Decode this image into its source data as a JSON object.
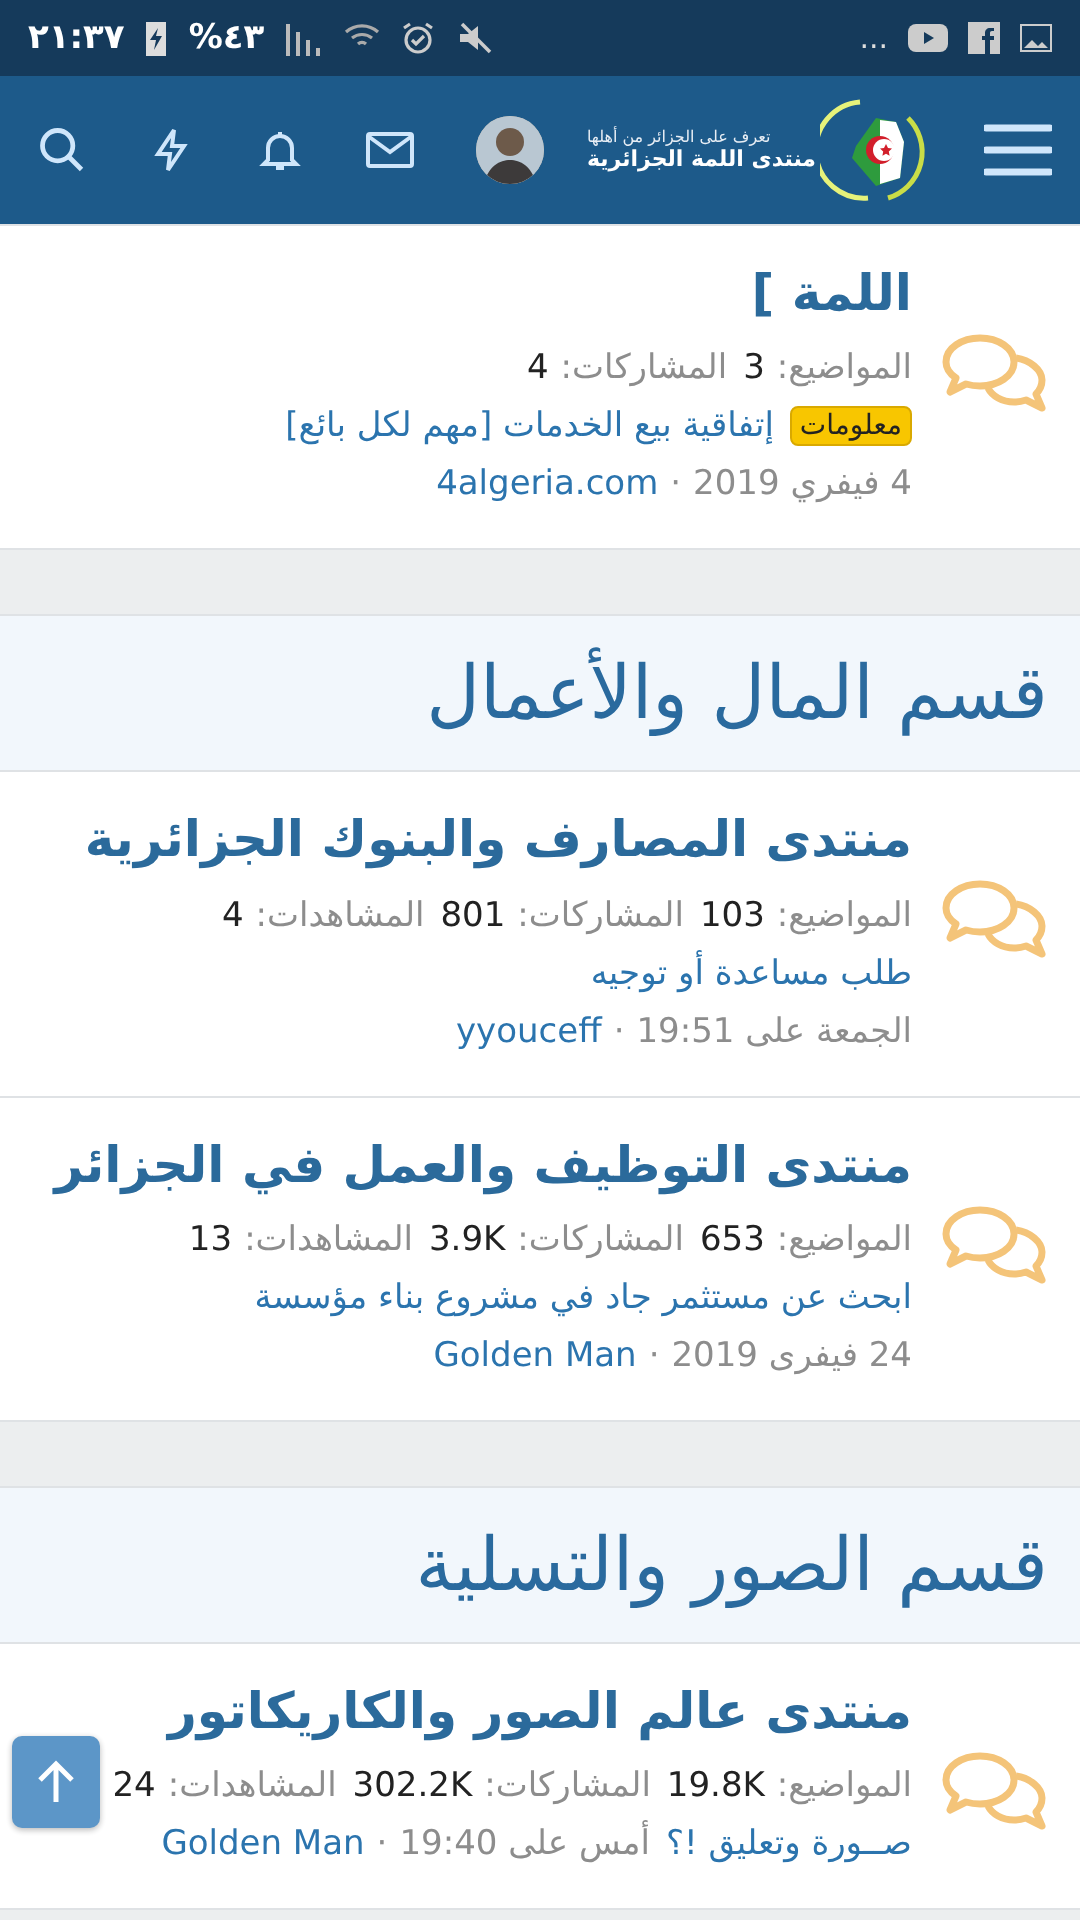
{
  "status_bar": {
    "time": "٢١:٣٧",
    "battery": "%٤٣",
    "more": "..."
  },
  "header": {
    "logo_title": "منتدى اللمة الجزائرية",
    "logo_tagline": "تعرف على الجزائر من أهلها"
  },
  "blocks": [
    {
      "forums": [
        {
          "title": "اللمة ]",
          "stats": [
            {
              "label": "المواضيع:",
              "value": "3"
            },
            {
              "label": "المشاركات:",
              "value": "4"
            }
          ],
          "last_post": {
            "kind": "stacked",
            "prefix": "معلومات",
            "title": "إتفاقية بيع الخدمات [مهم لكل بائع]",
            "date": "4 فيفري 2019",
            "separator": "·",
            "user": "4algeria.com"
          }
        }
      ]
    },
    {
      "title": "قسم المال والأعمال",
      "forums": [
        {
          "title": "منتدى المصارف والبنوك الجزائرية",
          "stats": [
            {
              "label": "المواضيع:",
              "value": "103"
            },
            {
              "label": "المشاركات:",
              "value": "801"
            },
            {
              "label": "المشاهدات:",
              "value": "4"
            }
          ],
          "last_post": {
            "kind": "stacked",
            "title": "طلب مساعدة أو توجيه",
            "date": "الجمعة على 19:51",
            "separator": "·",
            "user": "yyouceff"
          }
        },
        {
          "title": "منتدى التوظيف والعمل في الجزائر",
          "stats": [
            {
              "label": "المواضيع:",
              "value": "653"
            },
            {
              "label": "المشاركات:",
              "value": "3.9K"
            },
            {
              "label": "المشاهدات:",
              "value": "13"
            }
          ],
          "last_post": {
            "kind": "stacked",
            "title": "ابحث عن مستثمر جاد في مشروع بناء مؤسسة",
            "date": "24 فيفرى 2019",
            "separator": "·",
            "user": "Golden Man"
          }
        }
      ]
    },
    {
      "title": "قسم الصور والتسلية",
      "forums": [
        {
          "title": "منتدى عالم الصور والكاريكاتور",
          "stats": [
            {
              "label": "المواضيع:",
              "value": "19.8K"
            },
            {
              "label": "المشاركات:",
              "value": "302.2K"
            },
            {
              "label": "المشاهدات:",
              "value": "24"
            }
          ],
          "last_post": {
            "kind": "inline",
            "title": "صــورة وتعليق !؟",
            "date": "أمس على 19:40",
            "separator": "·",
            "user": "Golden Man"
          }
        }
      ]
    }
  ]
}
